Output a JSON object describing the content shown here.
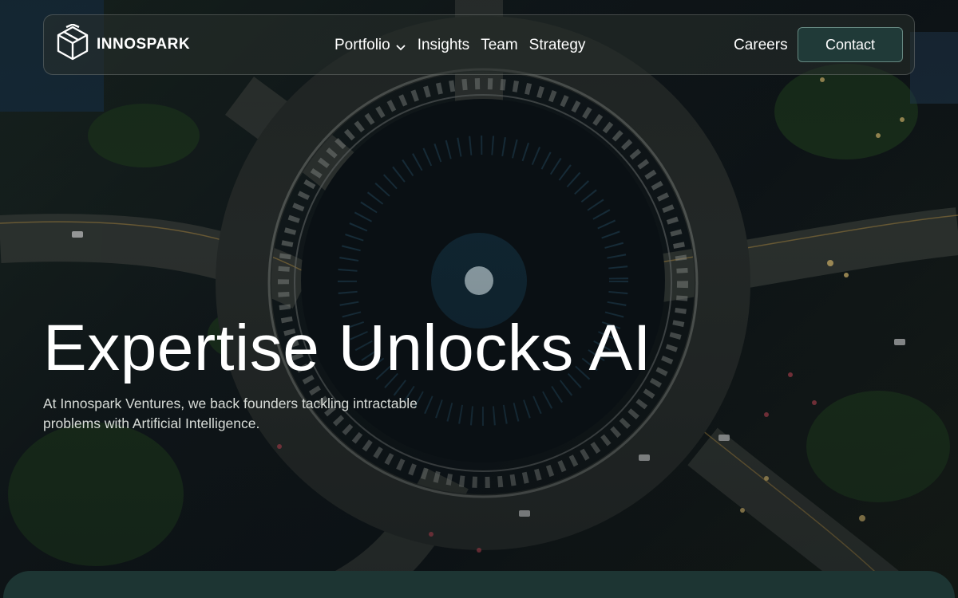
{
  "brand": {
    "name": "INNOSPARK",
    "logo_icon": "box-logo-icon"
  },
  "nav": {
    "items": [
      {
        "label": "Portfolio",
        "has_dropdown": true
      },
      {
        "label": "Insights"
      },
      {
        "label": "Team"
      },
      {
        "label": "Strategy"
      }
    ],
    "careers_label": "Careers",
    "contact_label": "Contact"
  },
  "hero": {
    "title": "Expertise Unlocks AI",
    "subtitle": "At Innospark Ventures, we back founders tackling intractable problems with Artificial Intelligence."
  },
  "colors": {
    "accent": "#203a38",
    "panel": "#1d3533",
    "text": "#ffffff"
  }
}
